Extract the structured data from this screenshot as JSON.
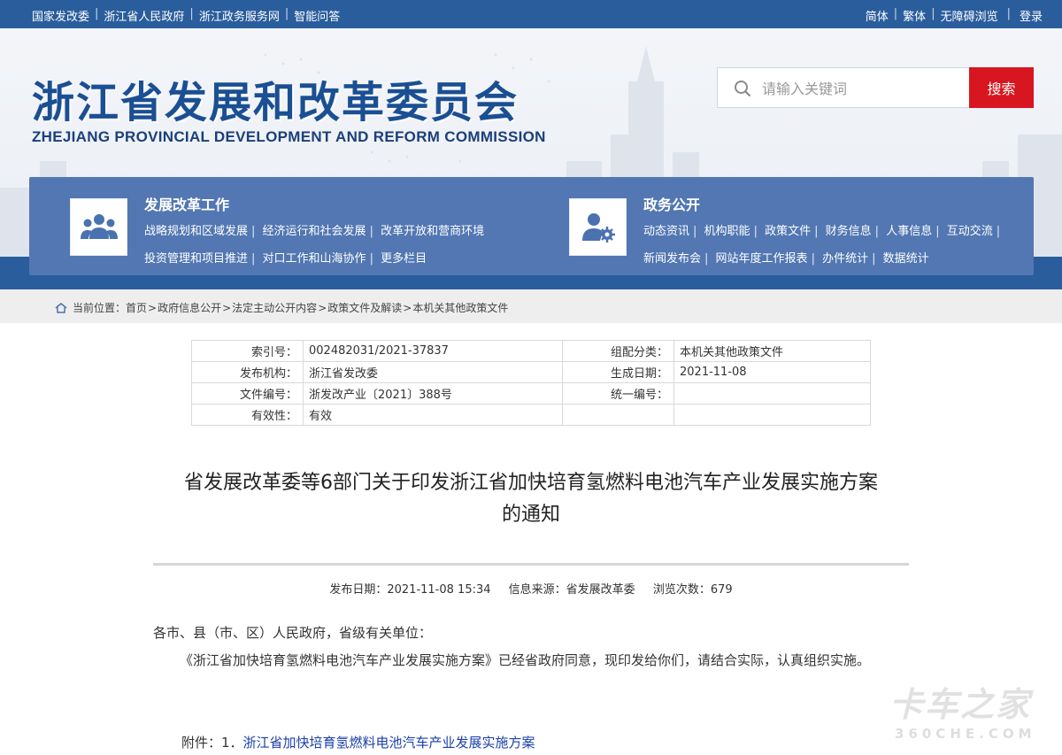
{
  "topbar": {
    "left_links": [
      "国家发改委",
      "浙江省人民政府",
      "浙江政务服务网",
      "智能问答"
    ],
    "right_links": [
      "简体",
      "繁体",
      "无障碍浏览"
    ],
    "login": "登录"
  },
  "header": {
    "title_cn": "浙江省发展和改革委员会",
    "title_en": "ZHEJIANG PROVINCIAL DEVELOPMENT AND REFORM COMMISSION"
  },
  "search": {
    "placeholder": "请输入关键词",
    "button": "搜索"
  },
  "nav": {
    "reform": {
      "title": "发展改革工作",
      "line1": [
        "战略规划和区域发展",
        "经济运行和社会发展",
        "改革开放和营商环境"
      ],
      "line2": [
        "投资管理和项目推进",
        "对口工作和山海协作",
        "更多栏目"
      ]
    },
    "affairs": {
      "title": "政务公开",
      "line1": [
        "动态资讯",
        "机构职能",
        "政策文件",
        "财务信息",
        "人事信息",
        "互动交流"
      ],
      "line2": [
        "新闻发布会",
        "网站年度工作报表",
        "办件统计",
        "数据统计"
      ]
    }
  },
  "breadcrumb": {
    "label": "当前位置：",
    "items": [
      "首页",
      "政府信息公开",
      "法定主动公开内容",
      "政策文件及解读",
      "本机关其他政策文件"
    ]
  },
  "meta": {
    "rows": [
      {
        "k1": "索引号：",
        "v1": "002482031/2021-37837",
        "k2": "组配分类：",
        "v2": "本机关其他政策文件"
      },
      {
        "k1": "发布机构：",
        "v1": "浙江省发改委",
        "k2": "生成日期：",
        "v2": "2021-11-08"
      },
      {
        "k1": "文件编号：",
        "v1": "浙发改产业〔2021〕388号",
        "k2": "统一编号：",
        "v2": ""
      },
      {
        "k1": "有效性：",
        "v1": "有效",
        "k2": "",
        "v2": ""
      }
    ]
  },
  "article": {
    "title_line1": "省发展改革委等6部门关于印发浙江省加快培育氢燃料电池汽车产业发展实施方案",
    "title_line2": "的通知",
    "publish_date": "发布日期：2021-11-08 15:34",
    "source": "信息来源：省发展改革委",
    "views": "浏览次数：679",
    "salutation": "各市、县（市、区）人民政府，省级有关单位：",
    "paragraph": "《浙江省加快培育氢燃料电池汽车产业发展实施方案》已经省政府同意，现印发给你们，请结合实际，认真组织实施。",
    "attachment_label": "附件：1．",
    "attachment_link": "浙江省加快培育氢燃料电池汽车产业发展实施方案"
  },
  "watermark": {
    "cn": "卡车之家",
    "en": "360CHE.COM"
  },
  "colors": {
    "topbar": "#2a5d9c",
    "nav": "#5277b2",
    "search_button": "#d7161f",
    "link": "#1a3fa8"
  }
}
